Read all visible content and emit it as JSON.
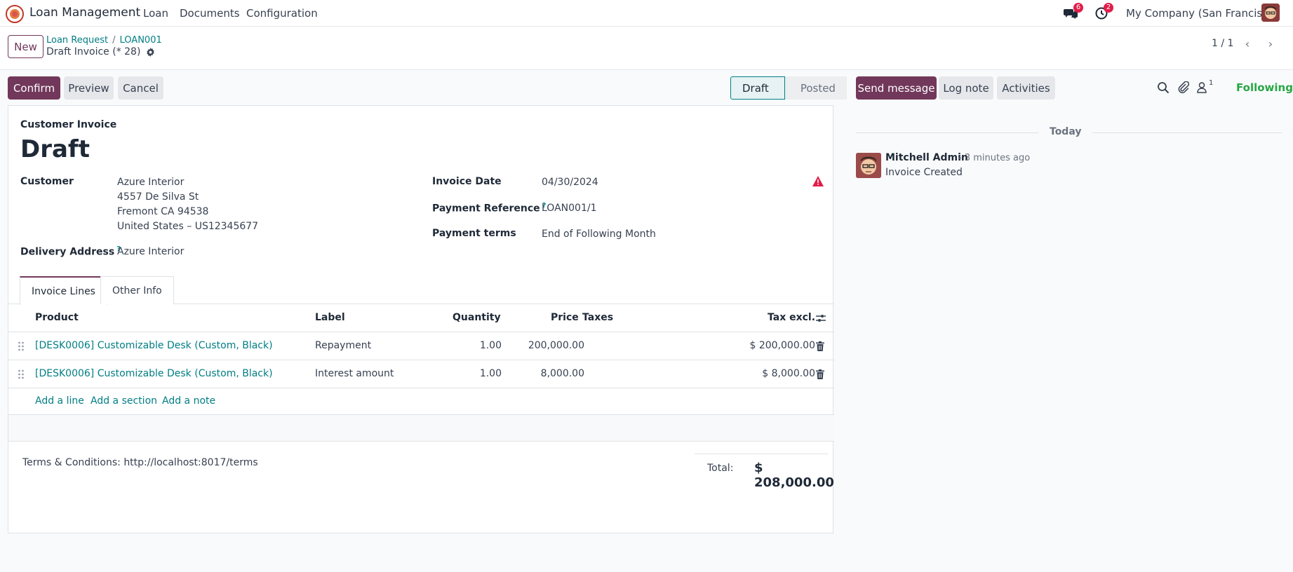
{
  "navbar": {
    "app_name": "Loan Management",
    "menu": [
      "Loan",
      "Documents",
      "Configuration"
    ],
    "messages_count": "6",
    "activities_count": "2",
    "company": "My Company (San Francisco)"
  },
  "control": {
    "new_label": "New",
    "breadcrumb": [
      "Loan Request",
      "LOAN001"
    ],
    "breadcrumb_sep": "/",
    "current": "Draft Invoice (* 28)",
    "pager": "1 / 1"
  },
  "actions": {
    "confirm": "Confirm",
    "preview": "Preview",
    "cancel": "Cancel",
    "status": [
      "Draft",
      "Posted"
    ]
  },
  "form": {
    "move_type": "Customer Invoice",
    "title": "Draft",
    "customer_label": "Customer",
    "customer_lines": [
      "Azure Interior",
      "4557 De Silva St",
      "Fremont CA 94538",
      "United States – US12345677"
    ],
    "delivery_label": "Delivery Address",
    "delivery_value": "Azure Interior",
    "invoice_date_label": "Invoice Date",
    "invoice_date": "04/30/2024",
    "payment_ref_label": "Payment Reference",
    "payment_ref": "LOAN001/1",
    "payment_terms_label": "Payment terms",
    "payment_terms": "End of Following Month",
    "help_mark": "?"
  },
  "tabs": [
    "Invoice Lines",
    "Other Info"
  ],
  "table": {
    "headers": [
      "Product",
      "Label",
      "Quantity",
      "Price",
      "Taxes",
      "Tax excl."
    ],
    "rows": [
      {
        "product": "[DESK0006] Customizable Desk (Custom, Black)",
        "label": "Repayment",
        "quantity": "1.00",
        "price": "200,000.00",
        "taxes": "",
        "subtotal": "$ 200,000.00"
      },
      {
        "product": "[DESK0006] Customizable Desk (Custom, Black)",
        "label": "Interest amount",
        "quantity": "1.00",
        "price": "8,000.00",
        "taxes": "",
        "subtotal": "$ 8,000.00"
      }
    ],
    "add_links": [
      "Add a line",
      "Add a section",
      "Add a note"
    ]
  },
  "footer": {
    "terms": "Terms & Conditions: http://localhost:8017/terms",
    "total_label": "Total:",
    "total_value": "$ 208,000.00"
  },
  "chatter": {
    "send_message": "Send message",
    "log_note": "Log note",
    "activities": "Activities",
    "followers_count": "1",
    "following": "Following",
    "today": "Today",
    "messages": [
      {
        "author": "Mitchell Admin",
        "time": "- 3 minutes ago",
        "body": "Invoice Created"
      }
    ]
  },
  "colors": {
    "brand": "#71385b",
    "link": "#017e84",
    "following": "#28a745",
    "badge": "#e11d48",
    "warning": "#e11d48"
  }
}
